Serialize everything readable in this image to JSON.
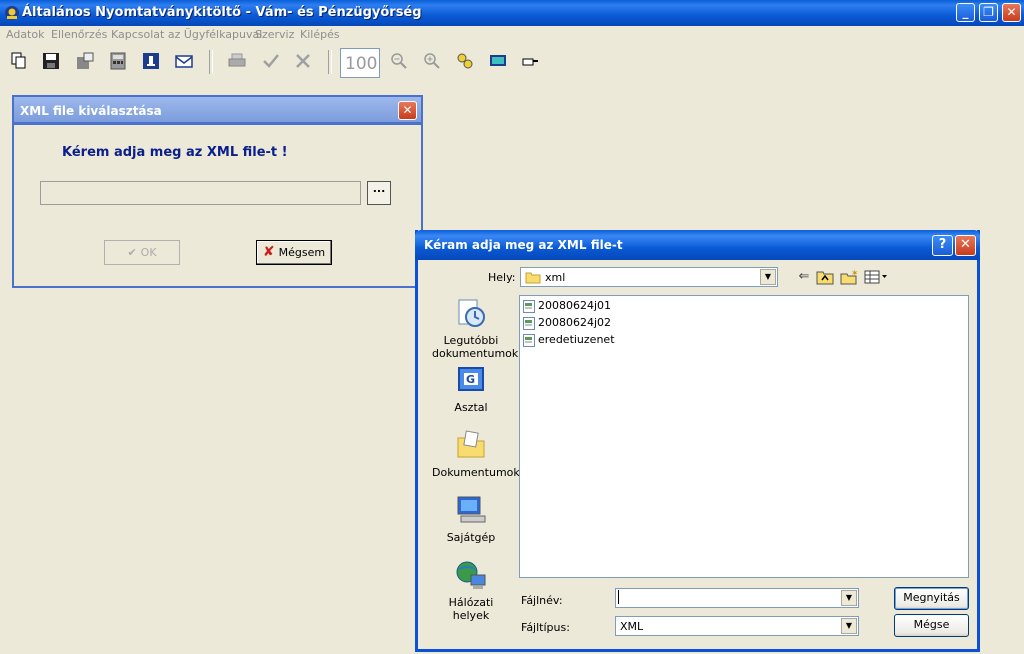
{
  "app": {
    "title": "Általános Nyomtatványkitöltő - Vám- és Pénzügyőrség",
    "window_buttons": {
      "minimize": "_",
      "maximize": "❐",
      "close": "✕"
    }
  },
  "menu": [
    "Adatok",
    "Ellenőrzés",
    "Kapcsolat az Ügyfélkapuval",
    "Szerviz",
    "Kilépés"
  ],
  "toolbar": {
    "zoom_value": "100",
    "icons": [
      "copy-icon",
      "save-icon",
      "export-icon",
      "calculator-icon",
      "info-icon",
      "mail-icon",
      "print-icon",
      "check-icon",
      "delete-icon",
      "zoom-out-icon",
      "zoom-in-icon",
      "search-icon",
      "screen-icon",
      "pointer-icon"
    ]
  },
  "dialog_xml": {
    "title": "XML file kiválasztása",
    "close": "✕",
    "prompt": "Kérem adja meg az XML file-t !",
    "path_value": "",
    "browse_label": "...",
    "ok_label": "OK",
    "cancel_label": "Mégsem"
  },
  "open_dialog": {
    "title": "Kéram adja meg az XML file-t",
    "help": "?",
    "close": "✕",
    "look_in_label": "Hely:",
    "look_in_value": "xml",
    "places": [
      {
        "label": "Legutóbbi dokumentumok",
        "icon": "recent-documents-icon"
      },
      {
        "label": "Asztal",
        "icon": "desktop-icon"
      },
      {
        "label": "Dokumentumok",
        "icon": "documents-icon"
      },
      {
        "label": "Sajátgép",
        "icon": "my-computer-icon"
      },
      {
        "label": "Hálózati helyek",
        "icon": "network-places-icon"
      }
    ],
    "files": [
      "20080624j01",
      "20080624j02",
      "eredetiuzenet"
    ],
    "filename_label": "Fájlnév:",
    "filename_value": "",
    "filetype_label": "Fájltípus:",
    "filetype_value": "XML",
    "open_label": "Megnyitás",
    "cancel_label": "Mégse"
  },
  "colors": {
    "xp_blue": "#0A5AD6",
    "dialog_face": "#ECE9D8",
    "prompt_text": "#0A1E8C",
    "close_red": "#C83C1C"
  }
}
